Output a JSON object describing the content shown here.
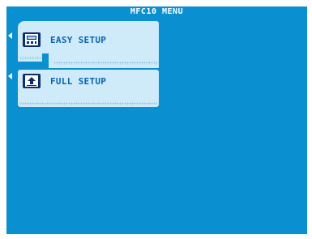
{
  "header": {
    "title": "MFC10 MENU"
  },
  "menu": {
    "items": [
      {
        "label": "EASY SETUP",
        "icon": "setup-wizard-icon",
        "selected": true
      },
      {
        "label": "FULL SETUP",
        "icon": "setup-upload-icon",
        "selected": false
      }
    ]
  },
  "colors": {
    "screen_bg": "#0a8fd0",
    "panel_bg": "#cfeaf8",
    "label_text": "#0a64b4",
    "title_text": "#ffffff"
  }
}
